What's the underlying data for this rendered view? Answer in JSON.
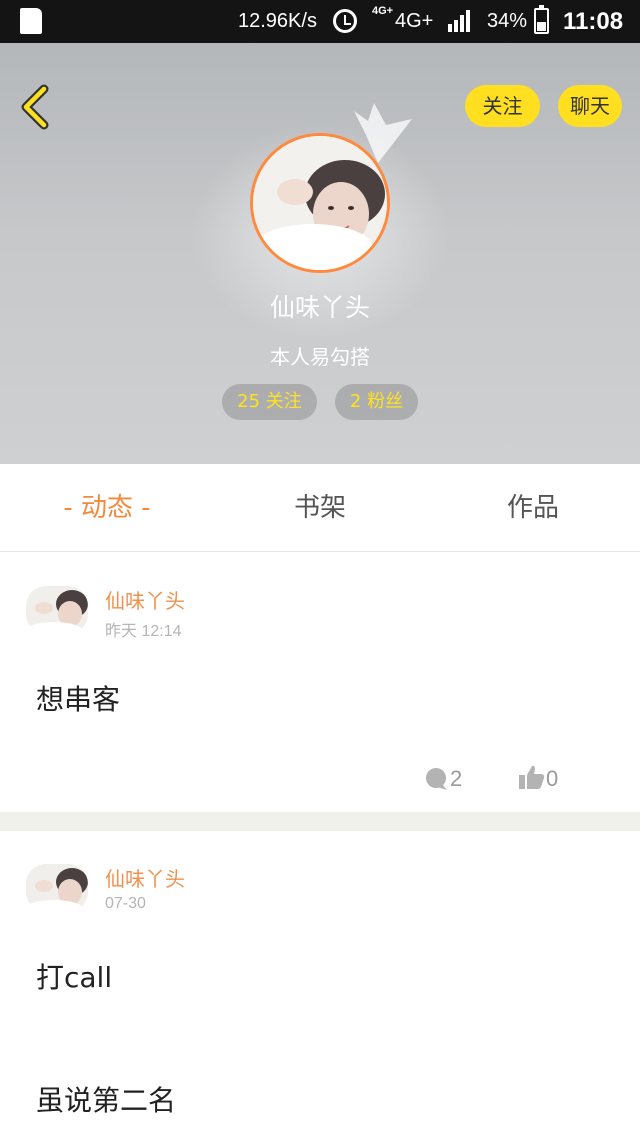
{
  "status_bar": {
    "speed": "12.96K/s",
    "network_small": "4G+",
    "network": "4G+",
    "battery": "34%",
    "time": "11:08",
    "icons": [
      "sd-card-icon",
      "alarm-icon",
      "signal-icon",
      "battery-icon"
    ]
  },
  "profile": {
    "follow_label": "关注",
    "chat_label": "聊天",
    "nickname": "仙味丫头",
    "bio": "本人易勾搭",
    "following": "25 关注",
    "fans": "2 粉丝",
    "accent": "#ffdf1f",
    "avatar_ring": "#ff8a3d"
  },
  "tabs": [
    {
      "label": "- 动态 -",
      "active": true
    },
    {
      "label": "书架",
      "active": false
    },
    {
      "label": "作品",
      "active": false
    }
  ],
  "posts": [
    {
      "author": "仙味丫头",
      "time": "昨天 12:14",
      "text": "想串客",
      "comments": "2",
      "likes": "0"
    },
    {
      "author": "仙味丫头",
      "time": "07-30",
      "text": "打call",
      "text2": "虽说第二名"
    }
  ],
  "colors": {
    "active_tab": "#f28a3e",
    "author": "#f0924e"
  }
}
